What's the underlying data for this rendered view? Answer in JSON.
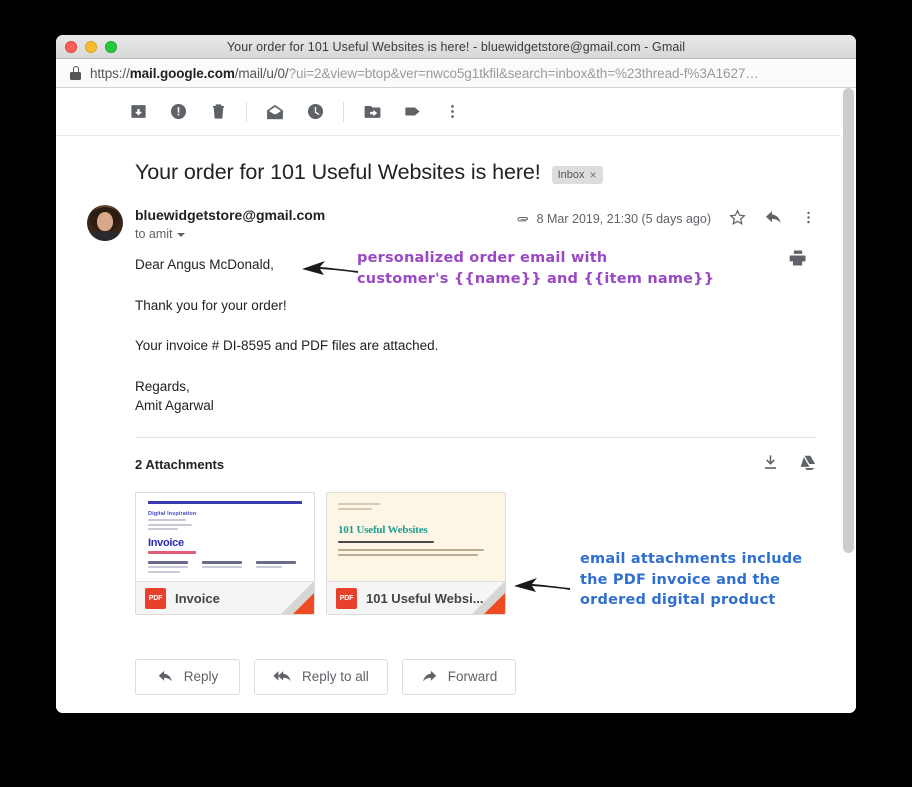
{
  "window": {
    "title": "Your order for 101 Useful Websites is here! - bluewidgetstore@gmail.com - Gmail",
    "traffic_lights": [
      "close",
      "minimize",
      "zoom"
    ]
  },
  "urlbar": {
    "lock_icon": "lock-icon",
    "url_host": "mail.google.com",
    "url_path": "/mail/u/0/",
    "url_query": "?ui=2&view=btop&ver=nwco5g1tkfil&search=inbox&th=%23thread-f%3A1627…",
    "scheme": "https://"
  },
  "toolbar": {
    "buttons": [
      {
        "name": "archive-icon",
        "label": "Archive"
      },
      {
        "name": "report-spam-icon",
        "label": "Report spam"
      },
      {
        "name": "delete-icon",
        "label": "Delete"
      },
      {
        "name": "mark-unread-icon",
        "label": "Mark as unread"
      },
      {
        "name": "snooze-icon",
        "label": "Snooze"
      },
      {
        "name": "move-to-icon",
        "label": "Move to"
      },
      {
        "name": "labels-icon",
        "label": "Labels"
      },
      {
        "name": "more-icon",
        "label": "More"
      }
    ]
  },
  "email": {
    "subject": "Your order for 101 Useful Websites is here!",
    "label_chip": "Inbox",
    "label_chip_remove": "×",
    "print_icon": "print-icon",
    "sender": "bluewidgetstore@gmail.com",
    "recipient": "to amit",
    "attachment_indicator_icon": "paperclip-icon",
    "date": "8 Mar 2019, 21:30 (5 days ago)",
    "star_icon": "star-icon",
    "reply_icon": "reply-arrow-icon",
    "more_icon": "more-vertical-icon",
    "body": {
      "greeting": "Dear Angus McDonald,",
      "thanks": "Thank you for your order!",
      "invoice_line": "Your invoice # DI-8595 and PDF files are attached.",
      "signoff": "Regards,",
      "sender_name": "Amit Agarwal"
    }
  },
  "attachments": {
    "heading": "2 Attachments",
    "download_icon": "download-icon",
    "drive_icon": "google-drive-icon",
    "items": [
      {
        "name": "Invoice",
        "type_badge": "PDF",
        "preview": {
          "brand": "Digital Inspiration",
          "title": "Invoice",
          "columns": [
            "Invoice for",
            "Payable to",
            "Invoice #"
          ]
        }
      },
      {
        "name": "101 Useful Websi...",
        "type_badge": "PDF",
        "preview": {
          "title": "101 Useful Websites"
        }
      }
    ]
  },
  "reply_buttons": [
    {
      "label": "Reply",
      "icon": "reply-arrow-icon"
    },
    {
      "label": "Reply to all",
      "icon": "reply-all-arrow-icon"
    },
    {
      "label": "Forward",
      "icon": "forward-arrow-icon"
    }
  ],
  "annotations": [
    {
      "text": "personalized order email with\ncustomer's {{name}} and {{item name}}",
      "color": "#9b48c4",
      "arrow": "left-arrow"
    },
    {
      "text": "email attachments include\nthe PDF invoice and the\nordered digital product",
      "color": "#2f6fd0",
      "arrow": "left-arrow"
    }
  ]
}
